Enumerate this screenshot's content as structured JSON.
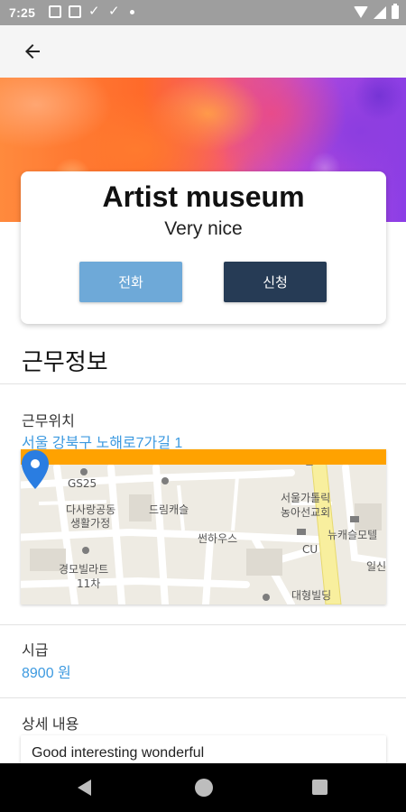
{
  "status_bar": {
    "time": "7:25"
  },
  "place": {
    "title": "Artist museum",
    "subtitle": "Very nice"
  },
  "actions": {
    "call_label": "전화",
    "apply_label": "신청"
  },
  "work_info": {
    "section_title": "근무정보",
    "location_label": "근무위치",
    "location_value": "서울 강북구 노해로7가길 1",
    "wage_label": "시급",
    "wage_value": "8900 원",
    "detail_label": "상세 내용",
    "detail_text": "Good interesting wonderful"
  },
  "map": {
    "labels": [
      "GS25",
      "다사랑공동",
      "생활가정",
      "드림캐슬",
      "경모빌라트",
      "11차",
      "썬하우스",
      "서울가톨릭",
      "농아선교회",
      "뉴캐슬모텔",
      "CU",
      "일신",
      "대형빌딩"
    ]
  },
  "colors": {
    "accent_link": "#3d9ae0",
    "call_button": "#6ea9d8",
    "apply_button": "#263b55",
    "map_bar": "#ffa200",
    "map_pin": "#2a7de1"
  }
}
